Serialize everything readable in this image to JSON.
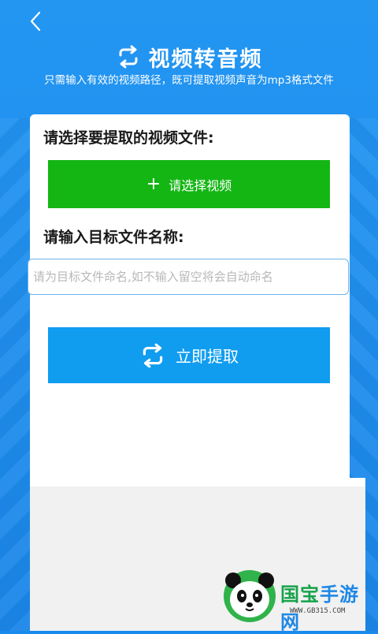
{
  "header": {
    "title": "视频转音频",
    "subtitle": "只需输入有效的视频路径，既可提取视频声音为mp3格式文件"
  },
  "form": {
    "select_label": "请选择要提取的视频文件:",
    "select_button_label": "请选择视频",
    "filename_label": "请输入目标文件名称:",
    "filename_value": "",
    "filename_placeholder": "请为目标文件命名,如不输入留空将会自动命名",
    "extract_button_label": "立即提取"
  },
  "watermark": {
    "brand_a": "国宝",
    "brand_b": "手游网",
    "url": "WWW.GB315.COM"
  },
  "colors": {
    "background": "#1b8ae9",
    "select_button": "#14b614",
    "extract_button": "#109df0",
    "input_border": "#6fb4ec"
  },
  "icons": {
    "back": "chevron-left-icon",
    "title": "refresh-arrows-icon",
    "plus": "plus-icon",
    "extract": "refresh-arrows-icon"
  }
}
